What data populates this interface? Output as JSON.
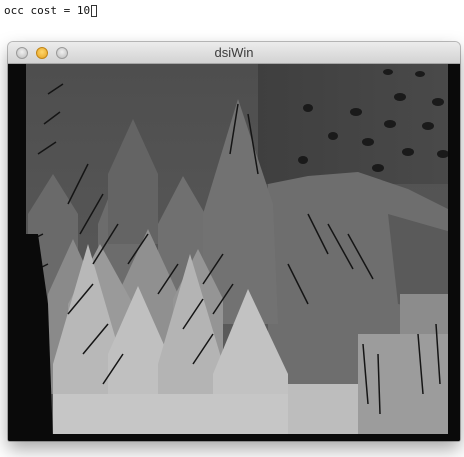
{
  "terminal": {
    "line": "occ cost = 10"
  },
  "window": {
    "title": "dsiWin",
    "buttons": {
      "close": "close",
      "minimize": "minimize",
      "zoom": "zoom"
    }
  },
  "image": {
    "description": "grayscale disparity map",
    "colors": {
      "background": "#111111",
      "far": "#4a4a4a",
      "mid": "#7a7a7a",
      "near": "#c8c8c8"
    }
  }
}
